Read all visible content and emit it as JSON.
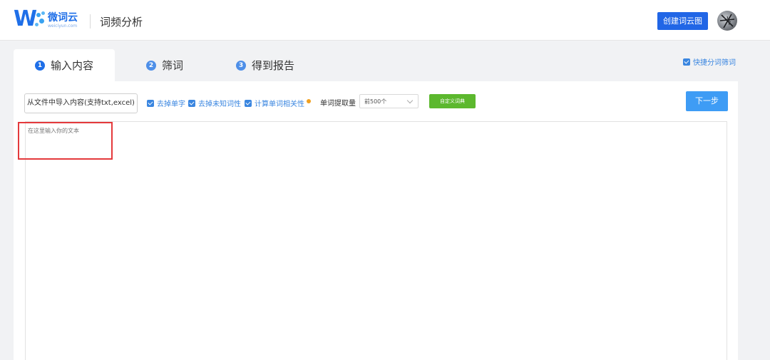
{
  "header": {
    "logo_name": "微词云",
    "logo_sub": "weiciyun.com",
    "page_title": "词频分析",
    "create_button": "创建词云图"
  },
  "tabs": [
    {
      "num": "1",
      "label": "输入内容",
      "active": true
    },
    {
      "num": "2",
      "label": "筛词",
      "active": false
    },
    {
      "num": "3",
      "label": "得到报告",
      "active": false
    }
  ],
  "quick_filter": {
    "label": "快捷分词筛词",
    "checked": true
  },
  "toolbar": {
    "import_button": "从文件中导入内容(支持txt,excel)",
    "options": [
      {
        "label": "去掉单字",
        "checked": true
      },
      {
        "label": "去掉未知词性",
        "checked": true
      },
      {
        "label": "计算单词相关性",
        "checked": true
      }
    ],
    "extract_label": "单词提取量",
    "extract_value": "前500个",
    "dict_button": "自定义词典",
    "next_button": "下一步"
  },
  "editor": {
    "placeholder": "在这里输入你的文本"
  },
  "colors": {
    "primary": "#1f6fe8",
    "next": "#3e9cf5",
    "dict": "#5cb82e",
    "highlight": "#e4393c"
  }
}
